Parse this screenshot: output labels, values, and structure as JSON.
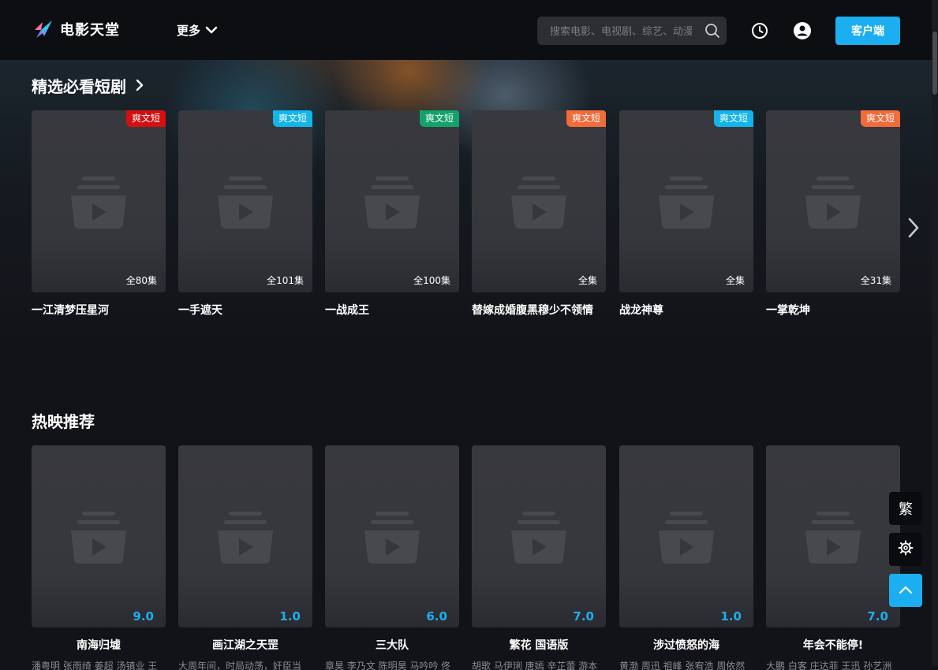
{
  "header": {
    "logo_text": "电影天堂",
    "more_label": "更多",
    "search_placeholder": "搜索电影、电视剧、综艺、动漫",
    "client_label": "客户端"
  },
  "colors": {
    "accent": "#1baef0",
    "badge_red": "#d50f0f",
    "badge_cyan": "#13b5ea",
    "badge_green": "#12a36a",
    "badge_orange": "#f26b3a"
  },
  "shorts": {
    "title": "精选必看短剧",
    "items": [
      {
        "title": "一江清梦压星河",
        "badge": "爽文短",
        "badge_color": "#d50f0f",
        "episodes": "全80集"
      },
      {
        "title": "一手遮天",
        "badge": "爽文短",
        "badge_color": "#13b5ea",
        "episodes": "全101集"
      },
      {
        "title": "一战成王",
        "badge": "爽文短",
        "badge_color": "#12a36a",
        "episodes": "全100集"
      },
      {
        "title": "替嫁成婚腹黑穆少不领情",
        "badge": "爽文短",
        "badge_color": "#f26b3a",
        "episodes": "全集"
      },
      {
        "title": "战龙神尊",
        "badge": "爽文短",
        "badge_color": "#13b5ea",
        "episodes": "全集"
      },
      {
        "title": "一掌乾坤",
        "badge": "爽文短",
        "badge_color": "#f26b3a",
        "episodes": "全31集"
      }
    ]
  },
  "hot": {
    "title": "热映推荐",
    "items": [
      {
        "title": "南海归墟",
        "score": "9.0",
        "cast": "潘粤明 张雨绮 姜超 汤镇业 王"
      },
      {
        "title": "画江湖之天罡",
        "score": "1.0",
        "cast": "大周年间，时局动荡，奸臣当"
      },
      {
        "title": "三大队",
        "score": "6.0",
        "cast": "章昊 李乃文 陈明昊 马吟吟 佟"
      },
      {
        "title": "繁花 国语版",
        "score": "7.0",
        "cast": "胡歌 马伊琍 唐嫣 辛芷蕾 游本"
      },
      {
        "title": "涉过愤怒的海",
        "score": "1.0",
        "cast": "黄渤 周迅 祖峰 张宥浩 周依然"
      },
      {
        "title": "年会不能停!",
        "score": "7.0",
        "cast": "大鹏 白客 庄达菲 王迅 孙艺洲"
      }
    ]
  },
  "floating": {
    "traditional_label": "繁",
    "settings_icon": "gear-icon",
    "top_icon": "chevron-up-icon"
  }
}
